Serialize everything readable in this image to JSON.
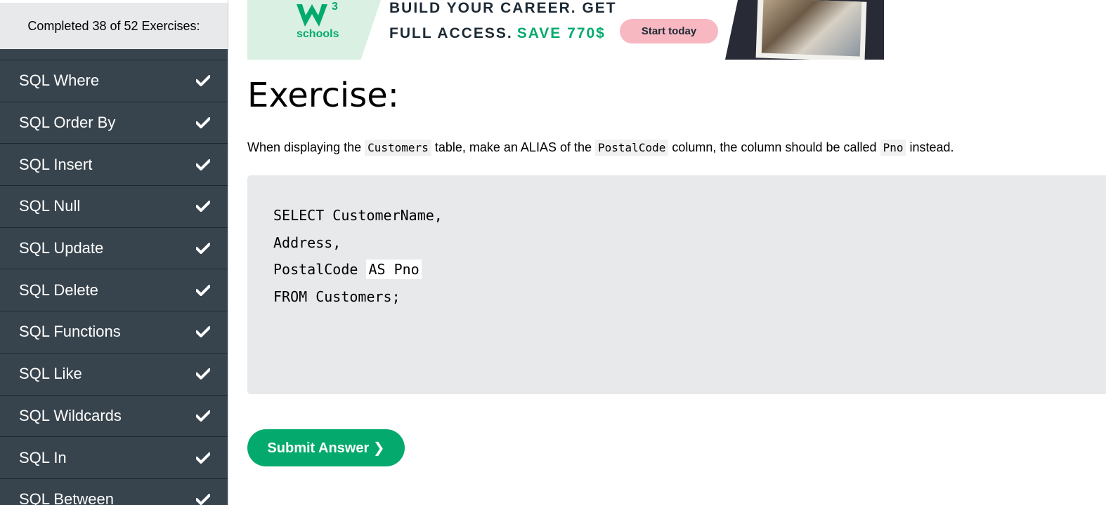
{
  "sidebar": {
    "progress_text": "Completed 38 of 52 Exercises:",
    "items": [
      {
        "label": "SQL Where",
        "icon": "check-icon"
      },
      {
        "label": "SQL Order By",
        "icon": "check-icon"
      },
      {
        "label": "SQL Insert",
        "icon": "check-icon"
      },
      {
        "label": "SQL Null",
        "icon": "check-icon"
      },
      {
        "label": "SQL Update",
        "icon": "check-icon"
      },
      {
        "label": "SQL Delete",
        "icon": "check-icon"
      },
      {
        "label": "SQL Functions",
        "icon": "check-icon"
      },
      {
        "label": "SQL Like",
        "icon": "check-icon"
      },
      {
        "label": "SQL Wildcards",
        "icon": "check-icon"
      },
      {
        "label": "SQL In",
        "icon": "check-icon"
      },
      {
        "label": "SQL Between",
        "icon": "check-icon"
      }
    ]
  },
  "banner": {
    "logo_superscript": "3",
    "logo_word": "schools",
    "line1": "BUILD YOUR CAREER. GET",
    "line2": "FULL ACCESS.",
    "save": "SAVE 770$",
    "cta": "Start today"
  },
  "exercise": {
    "heading": "Exercise:",
    "desc_parts": {
      "p1": "When displaying the",
      "code1": "Customers",
      "p2": "table, make an ALIAS of the",
      "code2": "PostalCode",
      "p3": "column, the column should be called",
      "code3": "Pno",
      "p4": "instead."
    },
    "code": {
      "line1": "SELECT CustomerName,",
      "line2": "Address,",
      "line3_prefix": "PostalCode ",
      "line3_input": "AS Pno",
      "line4": "FROM Customers;"
    },
    "submit_label": "Submit Answer ❯"
  },
  "colors": {
    "sidebar_bg": "#38444d",
    "accent_green": "#04aa6d",
    "code_bg": "#e7e9eb",
    "cta_pink": "#f7b8c2"
  }
}
